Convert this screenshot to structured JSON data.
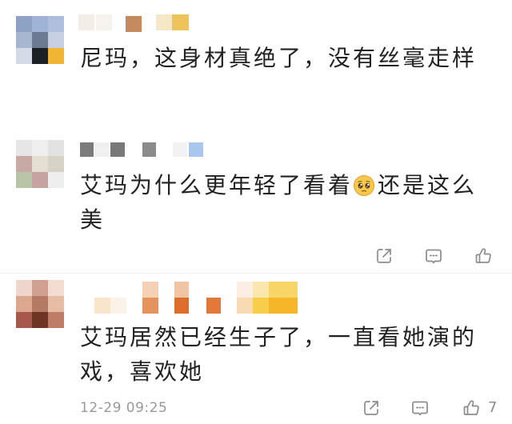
{
  "colors": {
    "text": "#222222",
    "meta": "#999999",
    "icon": "#8c8c8c",
    "divider": "#eeeeee",
    "emoji_face": "#f7c948"
  },
  "comments": [
    {
      "avatar_pixels": [
        [
          "#8ea2c6",
          "#9fb3d6",
          "#aebfdc"
        ],
        [
          "#a7b6d0",
          "#6b7a90",
          "#c6d0e2"
        ],
        [
          "#d4dae6",
          "#1c2126",
          "#f1b433"
        ]
      ],
      "line1": "尼玛，这身材真绝了，没有丝毫走样"
    },
    {
      "avatar_pixels": [
        [
          "#e6e6e6",
          "#efefef",
          "#e2e2e2"
        ],
        [
          "#c9a9a6",
          "#e4ddd2",
          "#d6d3c4"
        ],
        [
          "#b9c4a6",
          "#c6a3a1",
          "#eeeeee"
        ]
      ],
      "line1_before_emoji": "艾玛为什么更年轻了看着",
      "emoji": "pleading-face",
      "line1_after_emoji": "还是这么",
      "line2": "美",
      "actions": [
        "share-icon",
        "comment-icon",
        "thumbs-up-icon"
      ]
    },
    {
      "avatar_pixels": [
        [
          "#efd6cc",
          "#d2a090",
          "#f3ddd0"
        ],
        [
          "#dba88f",
          "#b57a64",
          "#e6bca4"
        ],
        [
          "#a8584a",
          "#6e3424",
          "#bf7c66"
        ]
      ],
      "line1": "艾玛居然已经生子了，一直看她演的",
      "line2": "戏，喜欢她",
      "timestamp": "12-29 09:25",
      "actions": [
        "share-icon",
        "comment-icon",
        "thumbs-up-icon"
      ],
      "like_count": "7"
    }
  ]
}
